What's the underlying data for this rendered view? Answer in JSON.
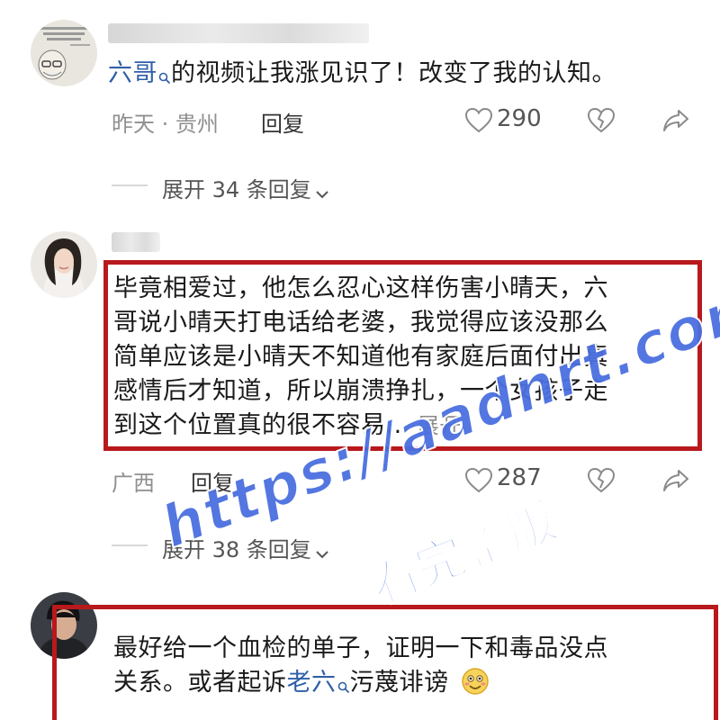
{
  "comments": [
    {
      "link_text": "六哥",
      "text": "的视频让我涨见识了！改变了我的认知。",
      "meta": "昨天 · 贵州",
      "reply_label": "回复",
      "like_count": "290",
      "expand_label": "展开 34 条回复"
    },
    {
      "text_lines": [
        "毕竟相爱过，他怎么忍心这样伤害小晴天，六",
        "哥说小晴天打电话给老婆，我觉得应该没那么",
        "简单应该是小晴天不知道他有家庭后面付出真",
        "感情后才知道，所以崩溃挣扎，一个女孩子走",
        "到这个位置真的很不容易..."
      ],
      "more_label": "展开",
      "meta": "广西",
      "reply_label": "回复",
      "like_count": "287",
      "expand_label": "展开 38 条回复"
    },
    {
      "line1": "最好给一个血检的单子，证明一下和毒品没点",
      "line2_prefix": "关系。或者起诉",
      "link_text": "老六",
      "line2_suffix": "污蔑诽谤"
    }
  ],
  "watermark": {
    "url": "https://aadnrt.com",
    "cta": "看完整版"
  },
  "colors": {
    "highlight_box": "#b8191c",
    "link": "#2f5fa8",
    "watermark": "#4a6fe0"
  },
  "icons": [
    "search-icon",
    "like-icon",
    "dislike-icon",
    "share-icon",
    "chevron-down-icon",
    "smile-emoji-icon"
  ]
}
